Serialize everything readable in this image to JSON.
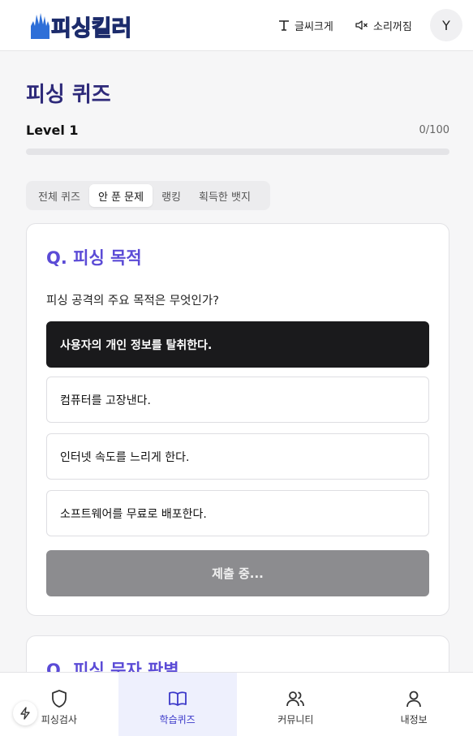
{
  "header": {
    "logo_text": "피싱킬러",
    "font_size_label": "글씨크게",
    "sound_label": "소리꺼짐",
    "avatar_initial": "Y"
  },
  "page": {
    "title": "피싱 퀴즈",
    "level_label": "Level 1",
    "score_text": "0/100",
    "progress_fraction": 0
  },
  "tabs": [
    {
      "label": "전체 퀴즈",
      "active": false
    },
    {
      "label": "안 푼 문제",
      "active": true
    },
    {
      "label": "랭킹",
      "active": false
    },
    {
      "label": "획득한 뱃지",
      "active": false
    }
  ],
  "question": {
    "title": "Q. 피싱 목적",
    "text": "피싱 공격의 주요 목적은 무엇인가?",
    "options": [
      {
        "label": "사용자의 개인 정보를 탈취한다.",
        "selected": true
      },
      {
        "label": "컴퓨터를 고장낸다.",
        "selected": false
      },
      {
        "label": "인터넷 속도를 느리게 한다.",
        "selected": false
      },
      {
        "label": "소프트웨어를 무료로 배포한다.",
        "selected": false
      }
    ],
    "submit_label": "제출 중..."
  },
  "question2": {
    "title": "Q. 피싱 문자 판별"
  },
  "bottom_nav": [
    {
      "label": "피싱검사",
      "icon": "shield-icon",
      "active": false
    },
    {
      "label": "학습퀴즈",
      "icon": "book-icon",
      "active": true
    },
    {
      "label": "커뮤니티",
      "icon": "users-icon",
      "active": false
    },
    {
      "label": "내정보",
      "icon": "user-icon",
      "active": false
    }
  ],
  "colors": {
    "accent": "#5b4bd6",
    "title": "#2e2a7a",
    "selected_option": "#1a1a1c",
    "submit_disabled": "#8c8c8f",
    "nav_active_bg": "#eef0fd"
  }
}
